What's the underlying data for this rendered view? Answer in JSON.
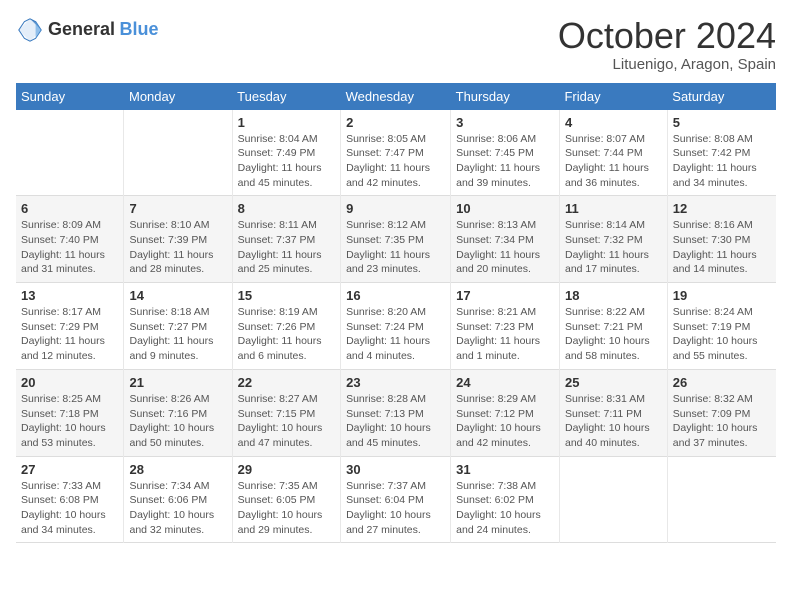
{
  "header": {
    "logo_general": "General",
    "logo_blue": "Blue",
    "month_title": "October 2024",
    "location": "Lituenigo, Aragon, Spain"
  },
  "weekdays": [
    "Sunday",
    "Monday",
    "Tuesday",
    "Wednesday",
    "Thursday",
    "Friday",
    "Saturday"
  ],
  "rows": [
    [
      {
        "day": "",
        "info": ""
      },
      {
        "day": "",
        "info": ""
      },
      {
        "day": "1",
        "info": "Sunrise: 8:04 AM\nSunset: 7:49 PM\nDaylight: 11 hours and 45 minutes."
      },
      {
        "day": "2",
        "info": "Sunrise: 8:05 AM\nSunset: 7:47 PM\nDaylight: 11 hours and 42 minutes."
      },
      {
        "day": "3",
        "info": "Sunrise: 8:06 AM\nSunset: 7:45 PM\nDaylight: 11 hours and 39 minutes."
      },
      {
        "day": "4",
        "info": "Sunrise: 8:07 AM\nSunset: 7:44 PM\nDaylight: 11 hours and 36 minutes."
      },
      {
        "day": "5",
        "info": "Sunrise: 8:08 AM\nSunset: 7:42 PM\nDaylight: 11 hours and 34 minutes."
      }
    ],
    [
      {
        "day": "6",
        "info": "Sunrise: 8:09 AM\nSunset: 7:40 PM\nDaylight: 11 hours and 31 minutes."
      },
      {
        "day": "7",
        "info": "Sunrise: 8:10 AM\nSunset: 7:39 PM\nDaylight: 11 hours and 28 minutes."
      },
      {
        "day": "8",
        "info": "Sunrise: 8:11 AM\nSunset: 7:37 PM\nDaylight: 11 hours and 25 minutes."
      },
      {
        "day": "9",
        "info": "Sunrise: 8:12 AM\nSunset: 7:35 PM\nDaylight: 11 hours and 23 minutes."
      },
      {
        "day": "10",
        "info": "Sunrise: 8:13 AM\nSunset: 7:34 PM\nDaylight: 11 hours and 20 minutes."
      },
      {
        "day": "11",
        "info": "Sunrise: 8:14 AM\nSunset: 7:32 PM\nDaylight: 11 hours and 17 minutes."
      },
      {
        "day": "12",
        "info": "Sunrise: 8:16 AM\nSunset: 7:30 PM\nDaylight: 11 hours and 14 minutes."
      }
    ],
    [
      {
        "day": "13",
        "info": "Sunrise: 8:17 AM\nSunset: 7:29 PM\nDaylight: 11 hours and 12 minutes."
      },
      {
        "day": "14",
        "info": "Sunrise: 8:18 AM\nSunset: 7:27 PM\nDaylight: 11 hours and 9 minutes."
      },
      {
        "day": "15",
        "info": "Sunrise: 8:19 AM\nSunset: 7:26 PM\nDaylight: 11 hours and 6 minutes."
      },
      {
        "day": "16",
        "info": "Sunrise: 8:20 AM\nSunset: 7:24 PM\nDaylight: 11 hours and 4 minutes."
      },
      {
        "day": "17",
        "info": "Sunrise: 8:21 AM\nSunset: 7:23 PM\nDaylight: 11 hours and 1 minute."
      },
      {
        "day": "18",
        "info": "Sunrise: 8:22 AM\nSunset: 7:21 PM\nDaylight: 10 hours and 58 minutes."
      },
      {
        "day": "19",
        "info": "Sunrise: 8:24 AM\nSunset: 7:19 PM\nDaylight: 10 hours and 55 minutes."
      }
    ],
    [
      {
        "day": "20",
        "info": "Sunrise: 8:25 AM\nSunset: 7:18 PM\nDaylight: 10 hours and 53 minutes."
      },
      {
        "day": "21",
        "info": "Sunrise: 8:26 AM\nSunset: 7:16 PM\nDaylight: 10 hours and 50 minutes."
      },
      {
        "day": "22",
        "info": "Sunrise: 8:27 AM\nSunset: 7:15 PM\nDaylight: 10 hours and 47 minutes."
      },
      {
        "day": "23",
        "info": "Sunrise: 8:28 AM\nSunset: 7:13 PM\nDaylight: 10 hours and 45 minutes."
      },
      {
        "day": "24",
        "info": "Sunrise: 8:29 AM\nSunset: 7:12 PM\nDaylight: 10 hours and 42 minutes."
      },
      {
        "day": "25",
        "info": "Sunrise: 8:31 AM\nSunset: 7:11 PM\nDaylight: 10 hours and 40 minutes."
      },
      {
        "day": "26",
        "info": "Sunrise: 8:32 AM\nSunset: 7:09 PM\nDaylight: 10 hours and 37 minutes."
      }
    ],
    [
      {
        "day": "27",
        "info": "Sunrise: 7:33 AM\nSunset: 6:08 PM\nDaylight: 10 hours and 34 minutes."
      },
      {
        "day": "28",
        "info": "Sunrise: 7:34 AM\nSunset: 6:06 PM\nDaylight: 10 hours and 32 minutes."
      },
      {
        "day": "29",
        "info": "Sunrise: 7:35 AM\nSunset: 6:05 PM\nDaylight: 10 hours and 29 minutes."
      },
      {
        "day": "30",
        "info": "Sunrise: 7:37 AM\nSunset: 6:04 PM\nDaylight: 10 hours and 27 minutes."
      },
      {
        "day": "31",
        "info": "Sunrise: 7:38 AM\nSunset: 6:02 PM\nDaylight: 10 hours and 24 minutes."
      },
      {
        "day": "",
        "info": ""
      },
      {
        "day": "",
        "info": ""
      }
    ]
  ]
}
